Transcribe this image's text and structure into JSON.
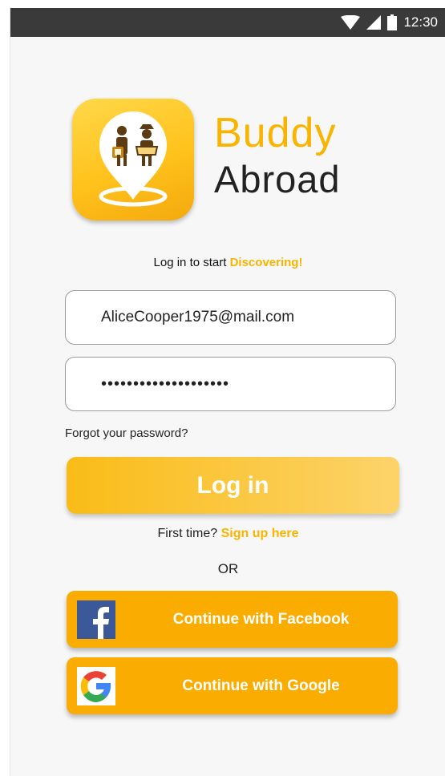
{
  "status_bar": {
    "time": "12:30"
  },
  "brand": {
    "line1": "Buddy",
    "line2": "Abroad"
  },
  "tagline": {
    "prefix": "Log in to start ",
    "accent": "Discovering!"
  },
  "form": {
    "email_value": "AliceCooper1975@mail.com",
    "password_value": "••••••••••••••••••••",
    "forgot_label": "Forgot your password?",
    "login_label": "Log in"
  },
  "signup": {
    "prefix": "First time? ",
    "link": "Sign up here"
  },
  "divider": "OR",
  "social": {
    "facebook_label": "Continue with Facebook",
    "google_label": "Continue with Google"
  },
  "colors": {
    "accent": "#f8b400",
    "button": "#fbac00",
    "facebook": "#3b5998"
  }
}
